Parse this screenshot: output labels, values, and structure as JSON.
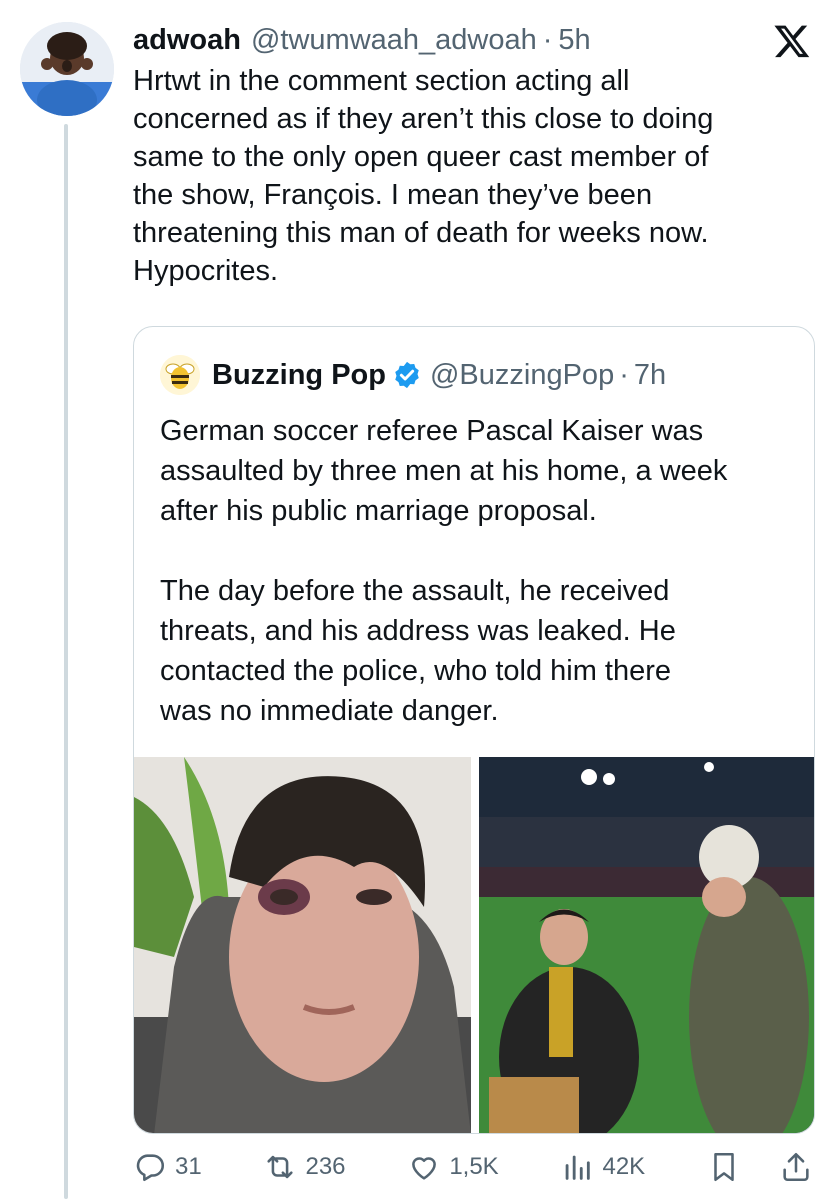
{
  "tweet": {
    "author_name": "adwoah",
    "author_handle": "@twumwaah_adwoah",
    "separator": "·",
    "time": "5h",
    "text": "Hrtwt in the comment section acting all\nconcerned as if they aren’t this close to doing\nsame to the only open queer cast member of\nthe show, François. I mean they’ve been\nthreatening this man of death for weeks now.\nHypocrites."
  },
  "quote": {
    "author_name": "Buzzing Pop",
    "author_handle": "@BuzzingPop",
    "separator": "·",
    "time": "7h",
    "text": "German soccer referee Pascal Kaiser was\nassaulted by three men at his home, a week\nafter his public marriage proposal.\n\nThe day before the assault, he received\nthreats, and his address was leaked. He\ncontacted the police, who told him there\nwas no immediate danger."
  },
  "actions": {
    "replies": "31",
    "reposts": "236",
    "likes": "1,5K",
    "views": "42K"
  },
  "icons": [
    "x-logo-icon",
    "verified-badge-icon",
    "reply-icon",
    "repost-icon",
    "like-icon",
    "views-icon",
    "bookmark-icon",
    "share-icon"
  ],
  "colors": {
    "text": "#0f1419",
    "secondary": "#536471",
    "verified": "#1d9bf0",
    "border": "#cfd9de"
  }
}
